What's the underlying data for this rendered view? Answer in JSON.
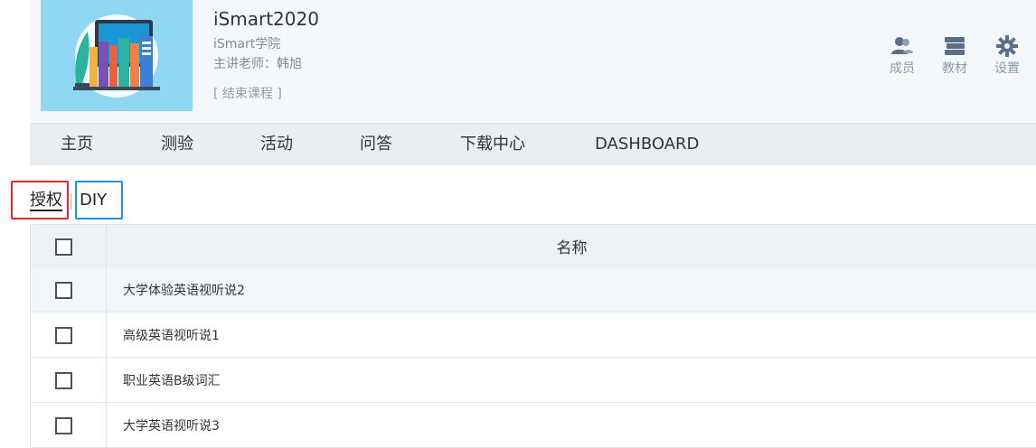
{
  "course": {
    "title": "iSmart2020",
    "org": "iSmart学院",
    "teacher": "主讲老师：韩旭",
    "end_label": "[ 结束课程 ]"
  },
  "toolbar": [
    {
      "label": "成员",
      "icon": "members-icon"
    },
    {
      "label": "教材",
      "icon": "textbook-icon"
    },
    {
      "label": "设置",
      "icon": "gear-icon"
    }
  ],
  "nav": [
    "主页",
    "测验",
    "活动",
    "问答",
    "下载中心",
    "DASHBOARD"
  ],
  "subtabs": {
    "auth": "授权",
    "diy": "DIY"
  },
  "table": {
    "header": "名称",
    "rows": [
      "大学体验英语视听说2",
      "高级英语视听说1",
      "职业英语B级词汇",
      "大学英语视听说3"
    ]
  },
  "colors": {
    "auth_border": "#e8262c",
    "diy_border": "#1e8fe6",
    "cover_bg": "#8fd7f2"
  }
}
